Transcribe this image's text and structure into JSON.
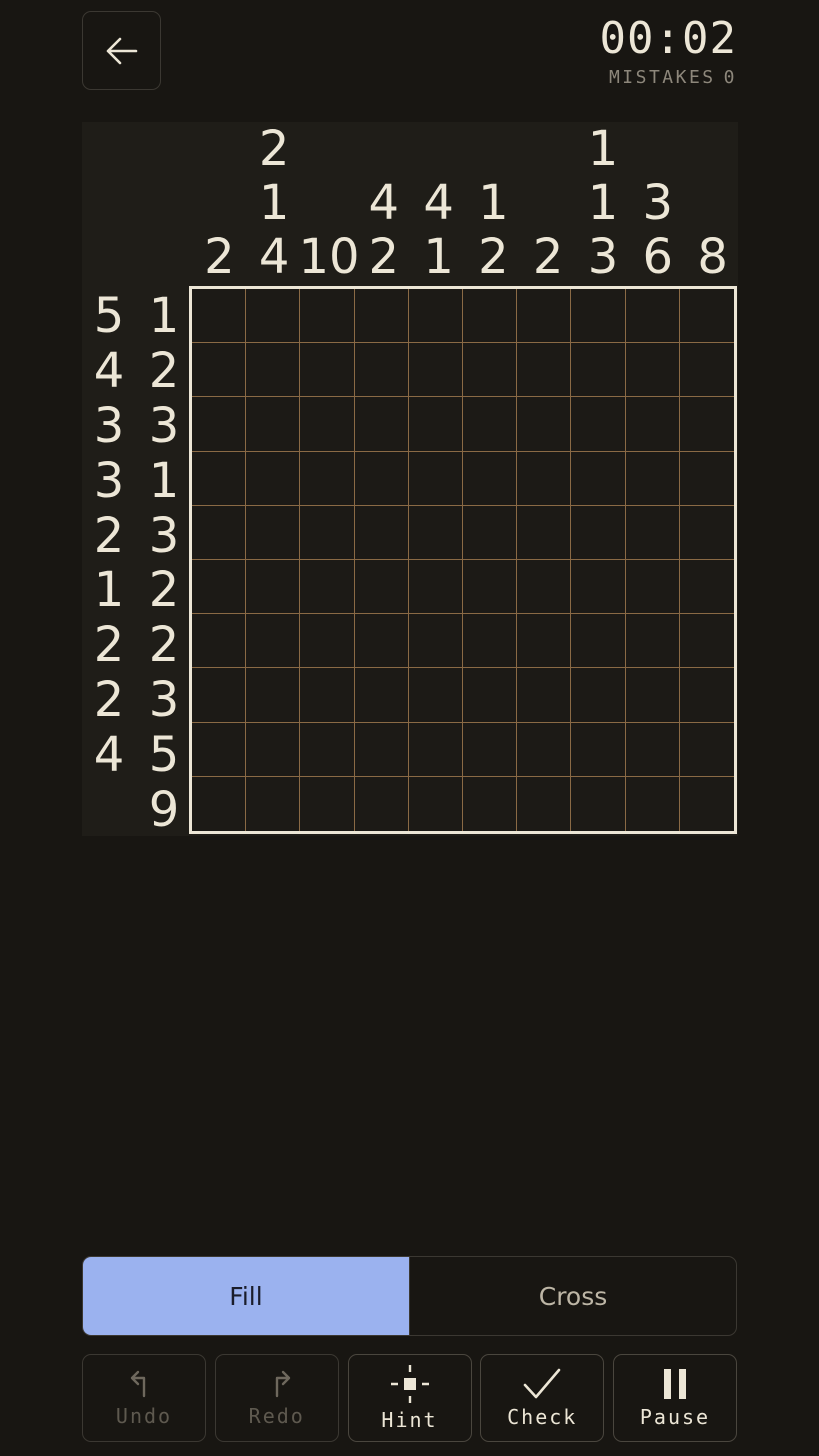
{
  "header": {
    "timer": "00:02",
    "mistakes_label": "MISTAKES",
    "mistakes_count": "0"
  },
  "puzzle": {
    "size": 10,
    "column_clues": [
      [
        "2"
      ],
      [
        "2",
        "1",
        "4"
      ],
      [
        "10"
      ],
      [
        "4",
        "2"
      ],
      [
        "4",
        "1"
      ],
      [
        "1",
        "2"
      ],
      [
        "2"
      ],
      [
        "1",
        "1",
        "3"
      ],
      [
        "3",
        "6"
      ],
      [
        "8"
      ]
    ],
    "row_clues": [
      [
        "5",
        "1"
      ],
      [
        "4",
        "2"
      ],
      [
        "3",
        "3"
      ],
      [
        "3",
        "1"
      ],
      [
        "2",
        "3"
      ],
      [
        "1",
        "2"
      ],
      [
        "2",
        "2"
      ],
      [
        "2",
        "3"
      ],
      [
        "4",
        "5"
      ],
      [
        "9"
      ]
    ]
  },
  "mode": {
    "fill_label": "Fill",
    "cross_label": "Cross",
    "selected": "Fill"
  },
  "toolbar": {
    "undo_label": "Undo",
    "redo_label": "Redo",
    "hint_label": "Hint",
    "check_label": "Check",
    "pause_label": "Pause"
  },
  "colors": {
    "background": "#181612",
    "accent": "#9bb2ef",
    "grid_line": "#8a6a45",
    "text": "#ece6d6"
  },
  "icons": {
    "back": "arrow-left-icon",
    "undo": "undo-icon",
    "redo": "redo-icon",
    "hint": "crosshair-icon",
    "check": "check-icon",
    "pause": "pause-icon"
  }
}
